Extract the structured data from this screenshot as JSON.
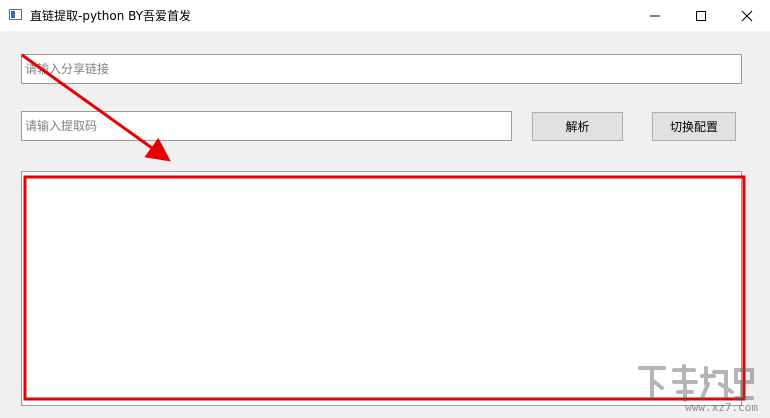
{
  "window": {
    "title": "直链提取-python BY吾爱首发",
    "icon": "app-window-icon",
    "controls": [
      "minimize-icon",
      "maximize-icon",
      "close-icon"
    ]
  },
  "inputs": {
    "share_link": {
      "value": "",
      "placeholder": "请输入分享链接"
    },
    "extract_code": {
      "value": "",
      "placeholder": "请输入提取码"
    }
  },
  "buttons": {
    "parse_label": "解析",
    "config_label": "切换配置"
  },
  "output": {
    "text": ""
  },
  "annotation": {
    "color": "#e60000"
  },
  "watermark": {
    "text": "www.xz7.com"
  }
}
